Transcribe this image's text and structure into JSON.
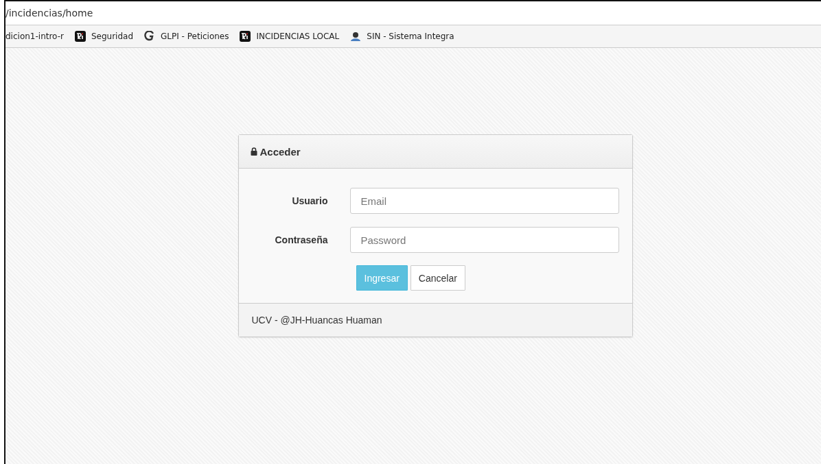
{
  "address_bar": {
    "url": "/incidencias/home"
  },
  "bookmarks": [
    {
      "label": "dicion1-intro-r",
      "kind": "none"
    },
    {
      "label": "Seguridad",
      "kind": "ri"
    },
    {
      "label": "GLPI - Peticiones",
      "kind": "glpi"
    },
    {
      "label": "INCIDENCIAS LOCAL",
      "kind": "ri"
    },
    {
      "label": "SIN - Sistema Integra",
      "kind": "person"
    }
  ],
  "login_panel": {
    "title": "Acceder",
    "fields": [
      {
        "label": "Usuario",
        "placeholder": "Email"
      },
      {
        "label": "Contraseña",
        "placeholder": "Password"
      }
    ],
    "buttons": [
      {
        "label": "Ingresar",
        "kind": "primary"
      },
      {
        "label": "Cancelar",
        "kind": "default"
      }
    ],
    "footer": "UCV - @JH-Huancas Huaman"
  }
}
